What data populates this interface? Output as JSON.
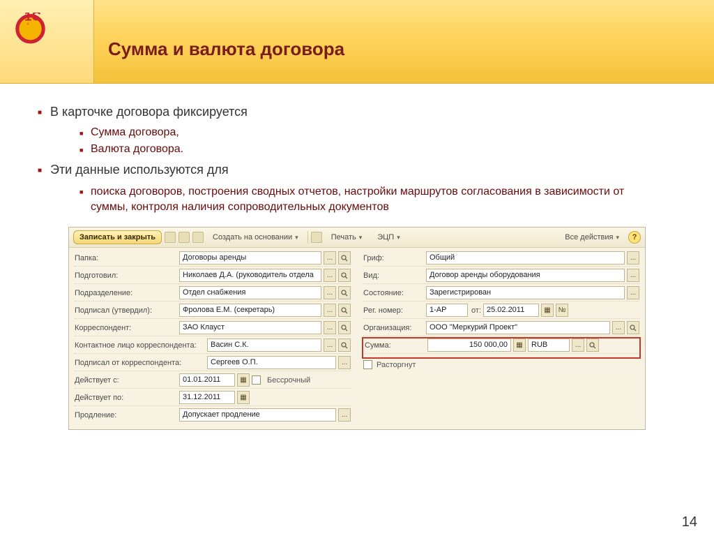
{
  "slide": {
    "title": "Сумма и валюта договора",
    "page_number": "14"
  },
  "bullets": {
    "b1_0": "В карточке договора фиксируется",
    "b2_0": "Сумма договора,",
    "b2_1": "Валюта договора.",
    "b1_1": "Эти данные используются для",
    "b2_2": "поиска договоров, построения сводных отчетов, настройки маршрутов согласования в зависимости от суммы, контроля наличия сопроводительных документов"
  },
  "toolbar": {
    "save_close": "Записать и закрыть",
    "create_on_basis": "Создать на основании",
    "print": "Печать",
    "ecp": "ЭЦП",
    "all_actions": "Все действия"
  },
  "left": {
    "folder_lbl": "Папка:",
    "folder_val": "Договоры аренды",
    "prepared_lbl": "Подготовил:",
    "prepared_val": "Николаев Д.А. (руководитель отдела",
    "dept_lbl": "Подразделение:",
    "dept_val": "Отдел снабжения",
    "approved_lbl": "Подписал (утвердил):",
    "approved_val": "Фролова Е.М. (секретарь)",
    "corr_lbl": "Корреспондент:",
    "corr_val": "ЗАО Клауст",
    "contact_lbl": "Контактное лицо корреспондента:",
    "contact_val": "Васин С.К.",
    "signed_lbl": "Подписал от корреспондента:",
    "signed_val": "Сергеев О.П.",
    "from_lbl": "Действует с:",
    "from_val": "01.01.2011",
    "perpetual": "Бессрочный",
    "to_lbl": "Действует по:",
    "to_val": "31.12.2011",
    "prolong_lbl": "Продление:",
    "prolong_val": "Допускает продление"
  },
  "right": {
    "grif_lbl": "Гриф:",
    "grif_val": "Общий",
    "kind_lbl": "Вид:",
    "kind_val": "Договор аренды оборудования",
    "state_lbl": "Состояние:",
    "state_val": "Зарегистрирован",
    "regno_lbl": "Рег. номер:",
    "regno_val": "1-АР",
    "from_lbl": "от:",
    "regdate": "25.02.2011",
    "num_btn": "№",
    "org_lbl": "Организация:",
    "org_val": "ООО \"Меркурий Проект\"",
    "sum_lbl": "Сумма:",
    "sum_val": "150 000,00",
    "currency": "RUB",
    "terminated": "Расторгнут"
  }
}
